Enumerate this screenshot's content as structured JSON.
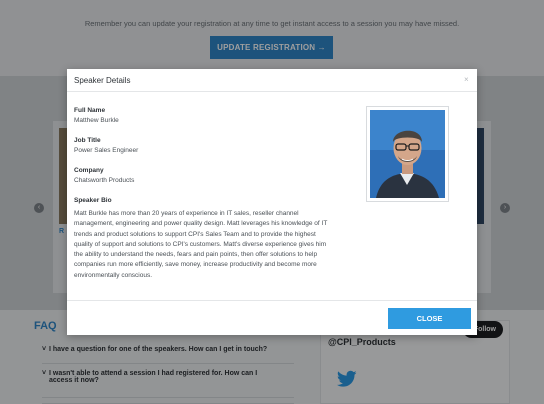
{
  "background": {
    "notice": "Remember you can update your registration at any time to get instant access to a session you may have missed.",
    "update_button": "UPDATE REGISTRATION →",
    "carousel_left_text": "R",
    "carousel_arrow_left": "‹",
    "carousel_arrow_right": "›",
    "faq_title": "FAQ",
    "faq_items": [
      "I have a question for one of the speakers. How can I get in touch?",
      "I wasn't able to attend a session I had registered for. How can I access it now?"
    ],
    "twitter_handle": "@CPI_Products",
    "follow_label": "Follow"
  },
  "modal": {
    "title": "Speaker Details",
    "close_x": "×",
    "full_name_label": "Full Name",
    "full_name": "Matthew Burkle",
    "job_title_label": "Job Title",
    "job_title": "Power Sales Engineer",
    "company_label": "Company",
    "company": "Chatsworth Products",
    "bio_label": "Speaker Bio",
    "bio": "Matt Burkle has more than 20 years of experience in IT sales, reseller channel management, engineering and power quality design. Matt leverages his knowledge of IT trends and product solutions to support CPI's Sales Team and to provide the highest quality of support and solutions to CPI's customers. Matt's diverse experience gives him the ability to understand the needs, fears and pain points, then offer solutions to help companies run more efficiently, save money, increase productivity and become more environmentally conscious.",
    "close_button": "CLOSE"
  },
  "colors": {
    "accent": "#2f86c8",
    "close_button": "#2f9be0",
    "overlay": "rgba(0,0,0,0.38)"
  }
}
